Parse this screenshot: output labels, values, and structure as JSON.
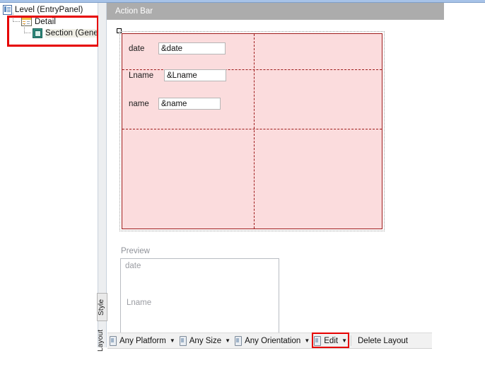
{
  "theme": {
    "accent_red": "#e60000",
    "grid_fill": "#fbdcdd",
    "grid_line": "#9e1b1b",
    "action_bar_bg": "#acacac",
    "toolbar_bg": "#f1f1f1"
  },
  "tree": {
    "nodes": [
      {
        "label": "Level (EntryPanel)",
        "icon": "level-icon",
        "depth": 0
      },
      {
        "label": "Detail",
        "icon": "detail-icon",
        "depth": 1
      },
      {
        "label": "Section (Genera",
        "icon": "section-icon",
        "depth": 2
      }
    ]
  },
  "editor": {
    "action_bar": {
      "title": "Action Bar"
    },
    "grid": {
      "columns": 2,
      "rows": 3,
      "fields": [
        {
          "label": "date",
          "value": "&date"
        },
        {
          "label": "Lname",
          "value": "&Lname"
        },
        {
          "label": "name",
          "value": "&name"
        }
      ]
    },
    "preview": {
      "title": "Preview",
      "items": [
        "date",
        "Lname"
      ]
    }
  },
  "side_tabs": [
    {
      "label": "Style",
      "selected": true
    },
    {
      "label": "Layout",
      "selected": false
    }
  ],
  "toolbar": {
    "items": [
      {
        "label": "Any Platform",
        "icon": "device-icon",
        "has_caret": true,
        "highlighted": false
      },
      {
        "label": "Any Size",
        "icon": "device-icon",
        "has_caret": true,
        "highlighted": false
      },
      {
        "label": "Any Orientation",
        "icon": "device-icon",
        "has_caret": true,
        "highlighted": false
      },
      {
        "label": "Edit",
        "icon": "device-icon",
        "has_caret": true,
        "highlighted": true
      },
      {
        "label": "Delete Layout",
        "icon": "none",
        "has_caret": false,
        "highlighted": false
      }
    ],
    "caret_glyph": "▼"
  }
}
